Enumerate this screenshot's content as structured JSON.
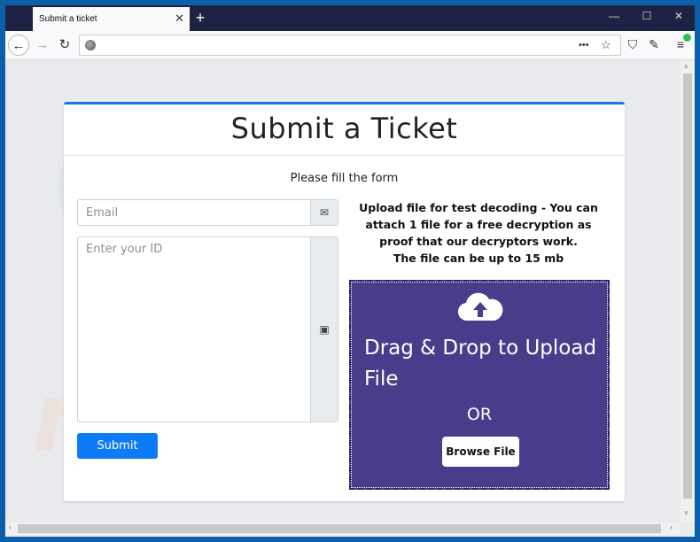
{
  "browser": {
    "tab_title": "Submit a ticket",
    "tab_close": "✕",
    "new_tab": "+",
    "window_controls": {
      "minimize": "—",
      "maximize": "☐",
      "close": "✕"
    },
    "nav": {
      "back": "←",
      "forward": "→",
      "reload": "↻"
    },
    "url": "",
    "page_actions": "•••",
    "bookmark": "☆",
    "shield": "⛉",
    "extension": "✎",
    "menu": "≡"
  },
  "page": {
    "title": "Submit a Ticket",
    "subtitle": "Please fill the form",
    "email": {
      "placeholder": "Email",
      "value": "",
      "icon": "✉"
    },
    "id": {
      "placeholder": "Enter your ID",
      "value": "",
      "icon": "▣"
    },
    "submit_label": "Submit",
    "upload_text_1": "Upload file for test decoding - You can attach 1 file for a free decryption as proof that our decryptors work.",
    "upload_text_2": "The file can be up to 15 mb",
    "dropzone": {
      "title": "Drag & Drop to Upload File",
      "or": "OR",
      "browse_label": "Browse File"
    }
  },
  "scroll": {
    "up": "˄",
    "down": "˅",
    "left": "‹",
    "right": "›"
  },
  "colors": {
    "accent": "#1a73e8",
    "submit": "#0d7bf7",
    "dropzone": "#483d8b",
    "tabbar": "#1f2343"
  }
}
